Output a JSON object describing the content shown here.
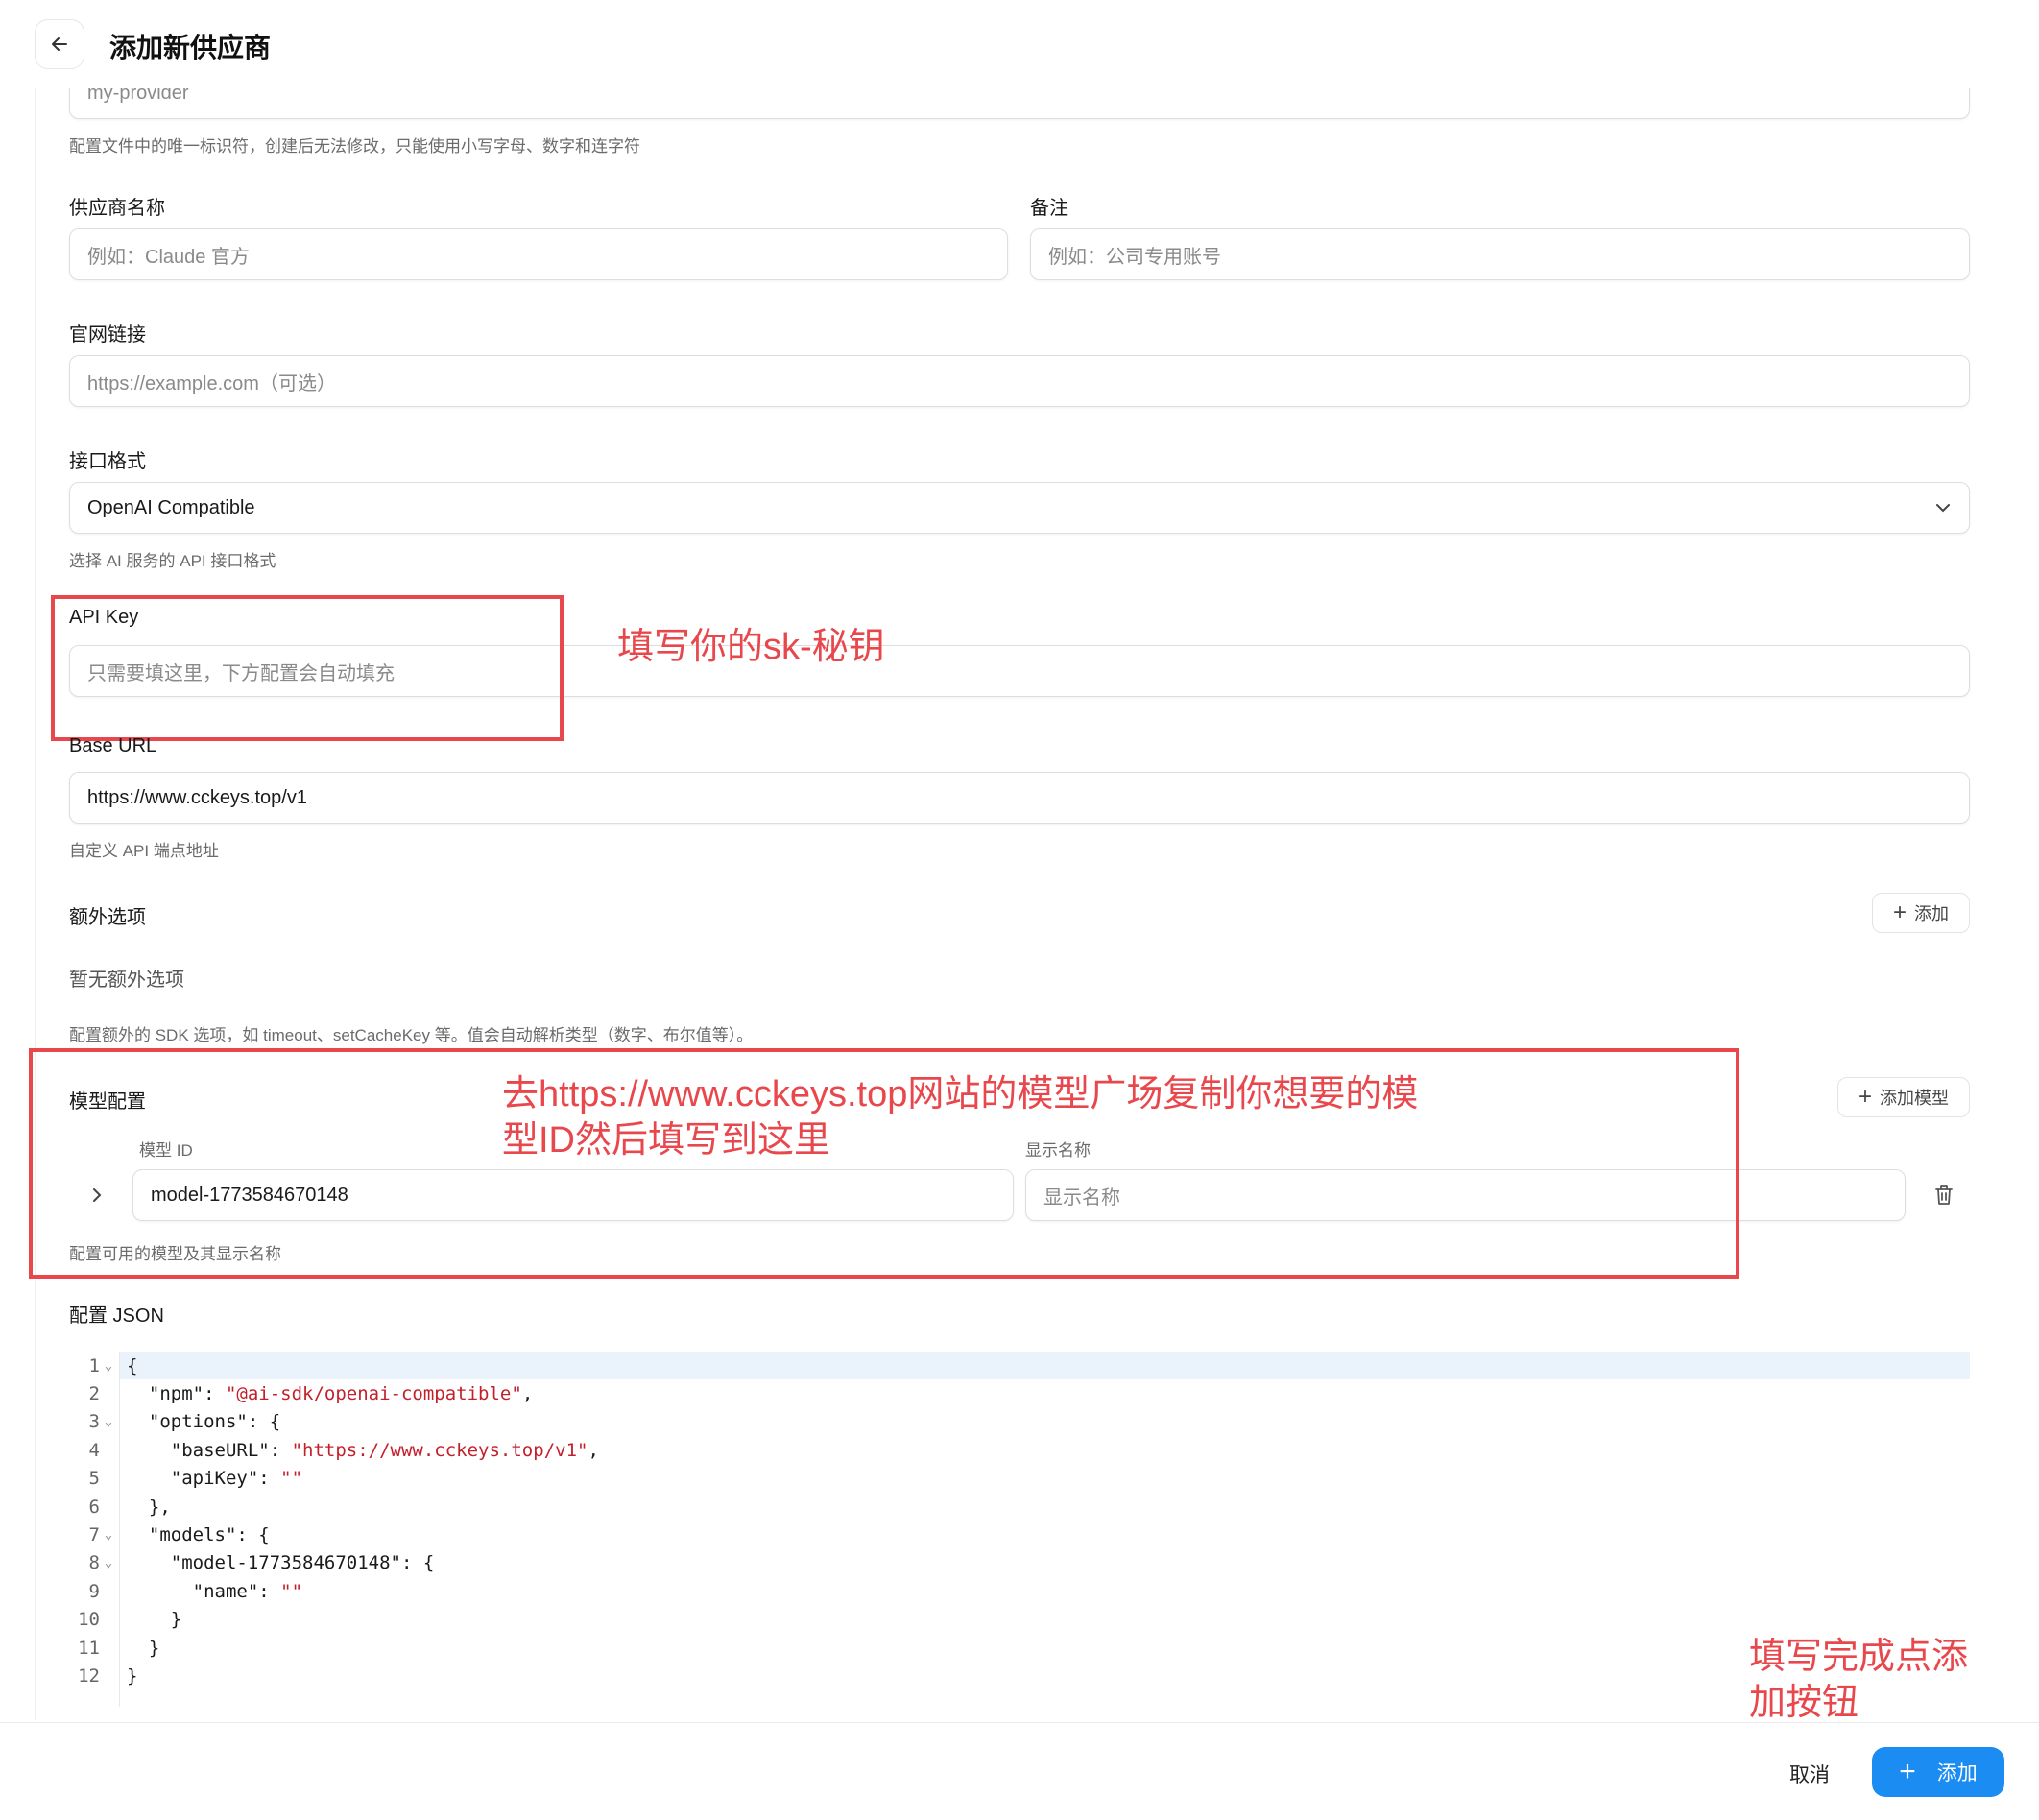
{
  "header": {
    "title": "添加新供应商"
  },
  "form": {
    "provider_id": {
      "value": "my-provider",
      "hint": "配置文件中的唯一标识符，创建后无法修改，只能使用小写字母、数字和连字符"
    },
    "provider_name": {
      "label": "供应商名称",
      "placeholder": "例如：Claude 官方"
    },
    "notes": {
      "label": "备注",
      "placeholder": "例如：公司专用账号"
    },
    "website": {
      "label": "官网链接",
      "placeholder": "https://example.com（可选）"
    },
    "api_format": {
      "label": "接口格式",
      "value": "OpenAI Compatible",
      "hint": "选择 AI 服务的 API 接口格式"
    },
    "api_key": {
      "label": "API Key",
      "placeholder": "只需要填这里，下方配置会自动填充"
    },
    "base_url": {
      "label": "Base URL",
      "value": "https://www.cckeys.top/v1",
      "hint": "自定义 API 端点地址"
    },
    "extra_options": {
      "label": "额外选项",
      "add_label": "添加",
      "empty_text": "暂无额外选项",
      "hint": "配置额外的 SDK 选项，如 timeout、setCacheKey 等。值会自动解析类型（数字、布尔值等）。"
    },
    "models": {
      "label": "模型配置",
      "add_label": "添加模型",
      "col_id": "模型 ID",
      "col_name": "显示名称",
      "row": {
        "id": "model-1773584670148",
        "name_placeholder": "显示名称"
      },
      "hint": "配置可用的模型及其显示名称"
    },
    "config_json": {
      "label": "配置 JSON",
      "lines": [
        {
          "n": "1",
          "fold": "⌄",
          "parts": [
            {
              "t": "{"
            }
          ]
        },
        {
          "n": "2",
          "fold": "",
          "parts": [
            {
              "t": "  \"npm\": "
            },
            {
              "t": "\"@ai-sdk/openai-compatible\"",
              "s": true
            },
            {
              "t": ","
            }
          ]
        },
        {
          "n": "3",
          "fold": "⌄",
          "parts": [
            {
              "t": "  \"options\": {"
            }
          ]
        },
        {
          "n": "4",
          "fold": "",
          "parts": [
            {
              "t": "    \"baseURL\": "
            },
            {
              "t": "\"https://www.cckeys.top/v1\"",
              "s": true
            },
            {
              "t": ","
            }
          ]
        },
        {
          "n": "5",
          "fold": "",
          "parts": [
            {
              "t": "    \"apiKey\": "
            },
            {
              "t": "\"\"",
              "s": true
            }
          ]
        },
        {
          "n": "6",
          "fold": "",
          "parts": [
            {
              "t": "  },"
            }
          ]
        },
        {
          "n": "7",
          "fold": "⌄",
          "parts": [
            {
              "t": "  \"models\": {"
            }
          ]
        },
        {
          "n": "8",
          "fold": "⌄",
          "parts": [
            {
              "t": "    \"model-1773584670148\": {"
            }
          ]
        },
        {
          "n": "9",
          "fold": "",
          "parts": [
            {
              "t": "      \"name\": "
            },
            {
              "t": "\"\"",
              "s": true
            }
          ]
        },
        {
          "n": "10",
          "fold": "",
          "parts": [
            {
              "t": "    }"
            }
          ]
        },
        {
          "n": "11",
          "fold": "",
          "parts": [
            {
              "t": "  }"
            }
          ]
        },
        {
          "n": "12",
          "fold": "",
          "parts": [
            {
              "t": "}"
            }
          ]
        }
      ]
    }
  },
  "annotations": {
    "api_key_note": "填写你的sk-秘钥",
    "model_note_1": "去https://www.cckeys.top网站的模型广场复制你想要的模",
    "model_note_2": "型ID然后填写到这里",
    "submit_note_1": "填写完成点添",
    "submit_note_2": "加按钮"
  },
  "footer": {
    "cancel_label": "取消",
    "add_label": "添加"
  },
  "colors": {
    "accent": "#1b8cf2",
    "annotation_red": "#e8474c",
    "json_string": "#c4202c"
  }
}
